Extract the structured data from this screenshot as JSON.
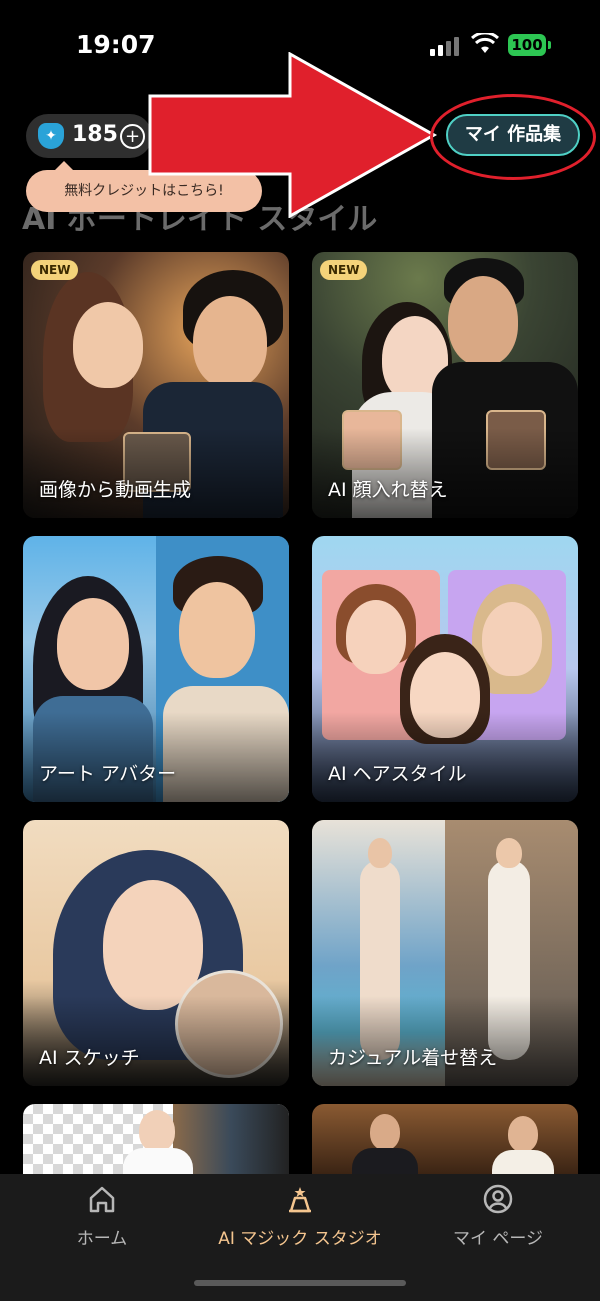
{
  "status_bar": {
    "time": "19:07",
    "battery": "100"
  },
  "header": {
    "credits": "185",
    "tooltip": "無料クレジットはこちら!",
    "my_works_label": "マイ 作品集",
    "section_title": "AI ポートレイト スタイル"
  },
  "cards": [
    {
      "label": "画像から動画生成",
      "badge": "NEW"
    },
    {
      "label": "AI 顔入れ替え",
      "badge": "NEW"
    },
    {
      "label": "アート アバター"
    },
    {
      "label": "AI ヘアスタイル"
    },
    {
      "label": "AI スケッチ"
    },
    {
      "label": "カジュアル着せ替え"
    }
  ],
  "tabs": [
    {
      "label": "ホーム"
    },
    {
      "label": "AI マジック スタジオ"
    },
    {
      "label": "マイ ページ"
    }
  ],
  "colors": {
    "accent": "#f4c58f",
    "highlight": "#e0202c",
    "my_works_border": "#4fd0c5"
  }
}
